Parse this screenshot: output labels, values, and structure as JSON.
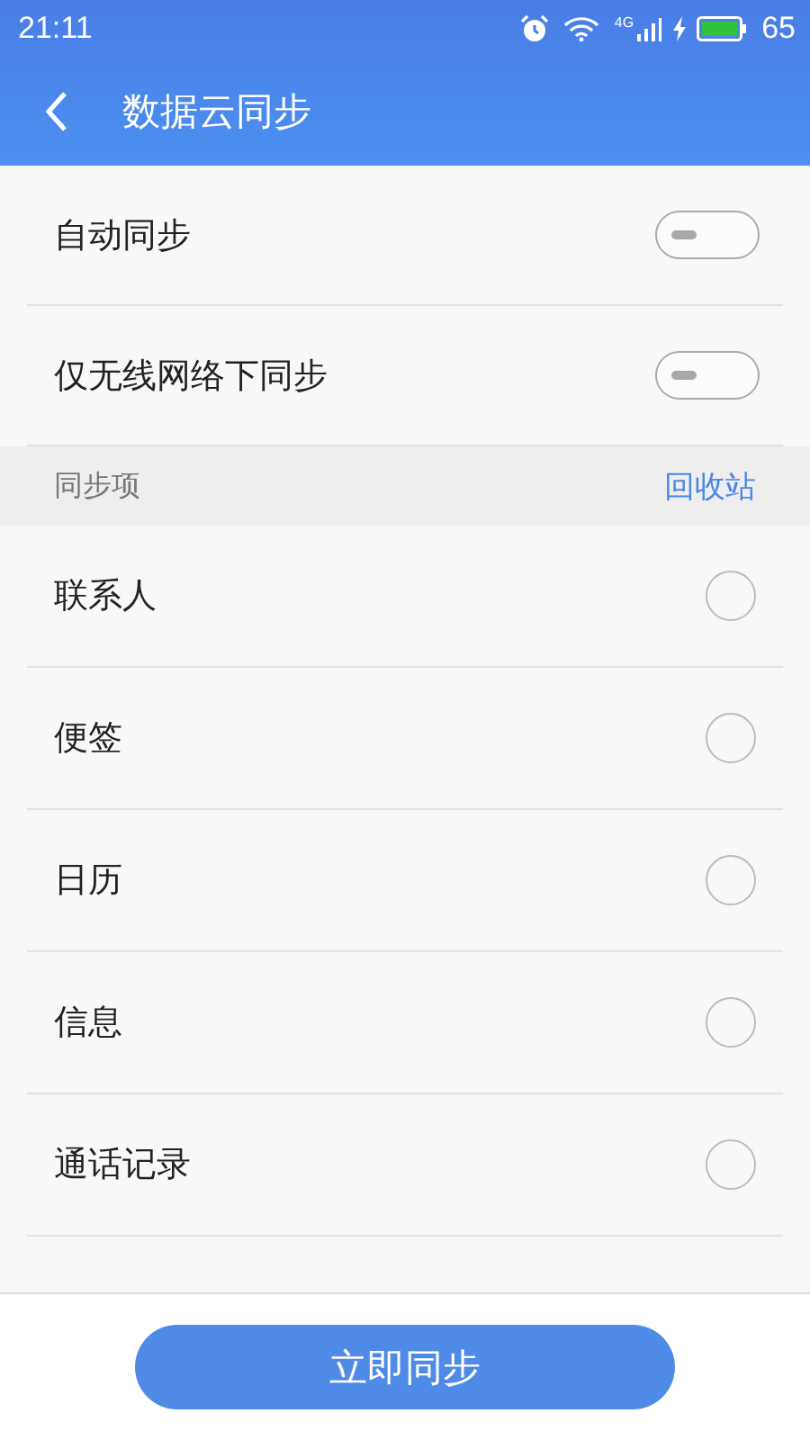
{
  "status_bar": {
    "time": "21:11",
    "network": "4G",
    "battery": "65"
  },
  "header": {
    "title": "数据云同步"
  },
  "settings": [
    {
      "label": "自动同步",
      "on": false
    },
    {
      "label": "仅无线网络下同步",
      "on": false
    }
  ],
  "section": {
    "title": "同步项",
    "link": "回收站"
  },
  "items": [
    {
      "label": "联系人",
      "checked": false
    },
    {
      "label": "便签",
      "checked": false
    },
    {
      "label": "日历",
      "checked": false
    },
    {
      "label": "信息",
      "checked": false
    },
    {
      "label": "通话记录",
      "checked": false
    }
  ],
  "sync_button": "立即同步"
}
